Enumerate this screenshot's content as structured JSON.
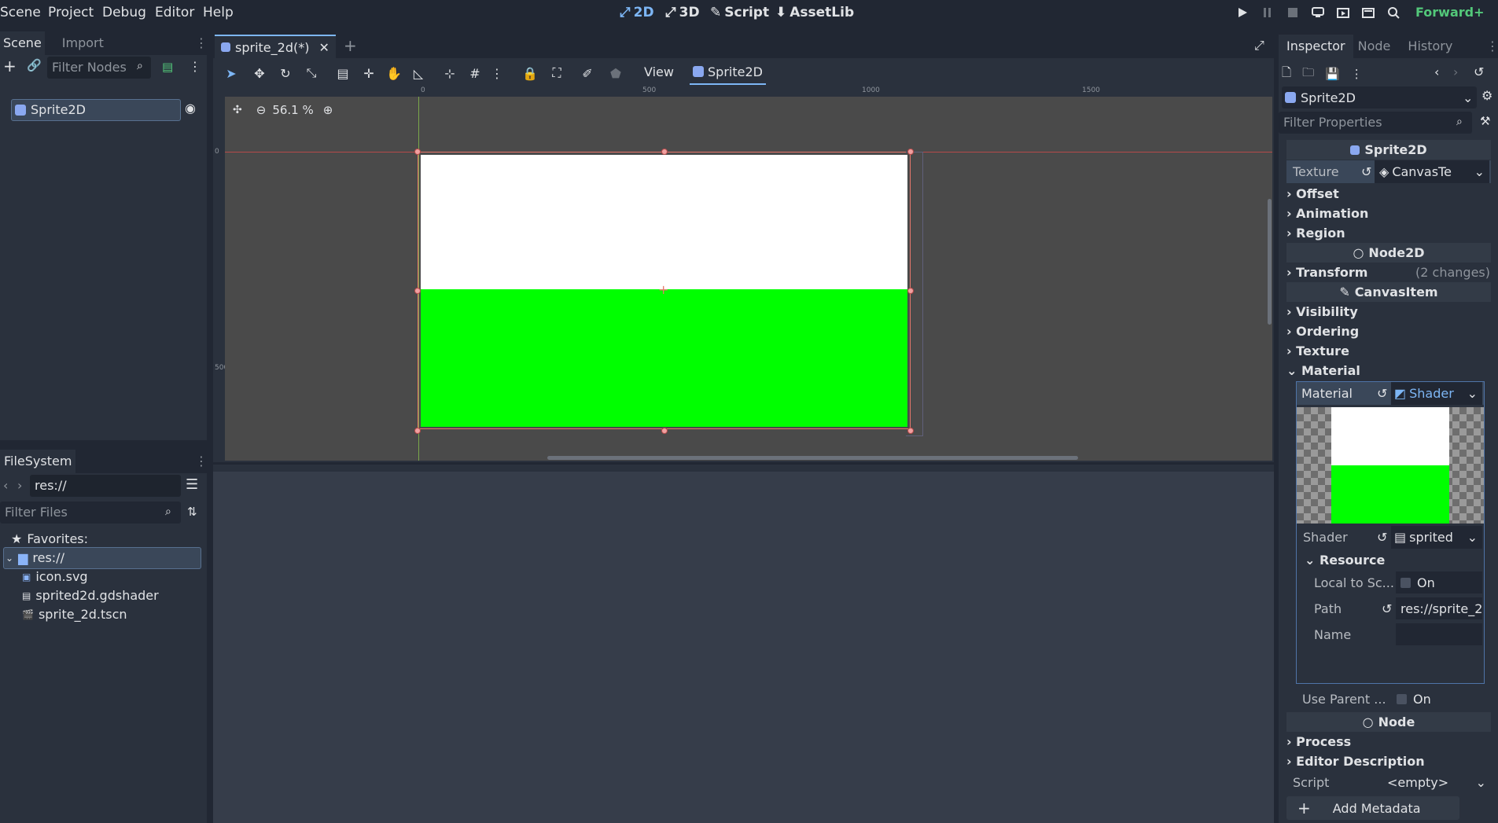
{
  "menu": [
    "Scene",
    "Project",
    "Debug",
    "Editor",
    "Help"
  ],
  "workspaces": [
    {
      "label": "2D",
      "active": true
    },
    {
      "label": "3D",
      "active": false
    },
    {
      "label": "Script",
      "active": false
    },
    {
      "label": "AssetLib",
      "active": false
    }
  ],
  "renderer": "Forward+",
  "scene_dock": {
    "tabs": [
      "Scene",
      "Import"
    ],
    "filter_placeholder": "Filter Nodes",
    "root_node": "Sprite2D"
  },
  "filesystem": {
    "tab": "FileSystem",
    "path": "res://",
    "filter_placeholder": "Filter Files",
    "favorites_label": "Favorites:",
    "root": "res://",
    "files": [
      "icon.svg",
      "sprited2d.gdshader",
      "sprite_2d.tscn"
    ]
  },
  "editor": {
    "tab_title": "sprite_2d(*)",
    "view_menu": "View",
    "selected_node": "Sprite2D",
    "zoom": "56.1 %",
    "ruler_ticks_h": [
      "0",
      "500",
      "1000",
      "1500"
    ],
    "ruler_ticks_v": [
      "0",
      "500"
    ]
  },
  "inspector": {
    "tabs": [
      "Inspector",
      "Node",
      "History"
    ],
    "object": "Sprite2D",
    "filter_placeholder": "Filter Properties",
    "sprite_header": "Sprite2D",
    "texture_label": "Texture",
    "texture_value": "CanvasTe",
    "groups_sprite": [
      "Offset",
      "Animation",
      "Region"
    ],
    "node2d_header": "Node2D",
    "transform_label": "Transform",
    "transform_changes": "(2 changes)",
    "canvasitem_header": "CanvasItem",
    "groups_canvas": [
      "Visibility",
      "Ordering",
      "Texture",
      "Material"
    ],
    "material_label": "Material",
    "material_value": "Shader",
    "shader_label": "Shader",
    "shader_value": "sprited",
    "resource_label": "Resource",
    "local_to_scene_label": "Local to Sc...",
    "local_to_scene_value": "On",
    "path_label": "Path",
    "path_value": "res://sprite_2",
    "name_label": "Name",
    "use_parent_label": "Use Parent ...",
    "use_parent_value": "On",
    "node_header": "Node",
    "groups_node": [
      "Process",
      "Editor Description"
    ],
    "script_label": "Script",
    "script_value": "<empty>",
    "add_metadata": "Add Metadata"
  },
  "colors": {
    "accent": "#7db6f5",
    "sprite_white": "#ffffff",
    "sprite_green": "#00ff00",
    "selection": "#e8776b"
  }
}
